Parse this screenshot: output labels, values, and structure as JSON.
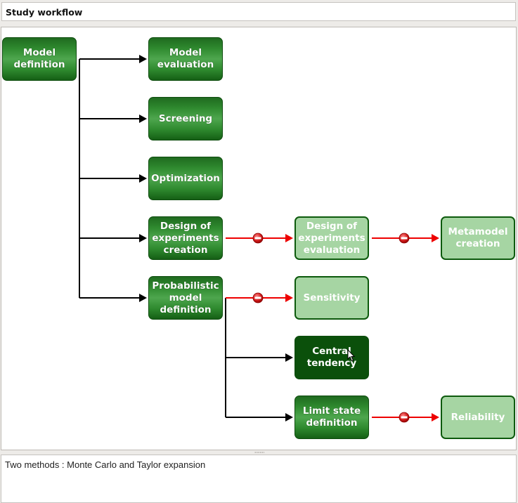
{
  "window": {
    "title": "Study workflow"
  },
  "workflow": {
    "nodes": [
      {
        "id": "model-definition",
        "label": "Model definition",
        "state": "active"
      },
      {
        "id": "model-evaluation",
        "label": "Model evaluation",
        "state": "active"
      },
      {
        "id": "screening",
        "label": "Screening",
        "state": "active"
      },
      {
        "id": "optimization",
        "label": "Optimization",
        "state": "active"
      },
      {
        "id": "doe-creation",
        "label": "Design of experiments creation",
        "state": "active"
      },
      {
        "id": "doe-evaluation",
        "label": "Design of experiments evaluation",
        "state": "inactive"
      },
      {
        "id": "metamodel-creation",
        "label": "Metamodel creation",
        "state": "inactive"
      },
      {
        "id": "probabilistic-model",
        "label": "Probabilistic model definition",
        "state": "active"
      },
      {
        "id": "sensitivity",
        "label": "Sensitivity",
        "state": "inactive"
      },
      {
        "id": "central-tendency",
        "label": "Central tendency",
        "state": "selected"
      },
      {
        "id": "limit-state",
        "label": "Limit state definition",
        "state": "active"
      },
      {
        "id": "reliability",
        "label": "Reliability",
        "state": "inactive"
      }
    ],
    "edges": [
      {
        "from": "model-definition",
        "to": "model-evaluation",
        "status": "enabled"
      },
      {
        "from": "model-definition",
        "to": "screening",
        "status": "enabled"
      },
      {
        "from": "model-definition",
        "to": "optimization",
        "status": "enabled"
      },
      {
        "from": "model-definition",
        "to": "doe-creation",
        "status": "enabled"
      },
      {
        "from": "model-definition",
        "to": "probabilistic-model",
        "status": "enabled"
      },
      {
        "from": "doe-creation",
        "to": "doe-evaluation",
        "status": "blocked"
      },
      {
        "from": "doe-evaluation",
        "to": "metamodel-creation",
        "status": "blocked"
      },
      {
        "from": "probabilistic-model",
        "to": "sensitivity",
        "status": "blocked"
      },
      {
        "from": "probabilistic-model",
        "to": "central-tendency",
        "status": "enabled"
      },
      {
        "from": "probabilistic-model",
        "to": "limit-state",
        "status": "enabled"
      },
      {
        "from": "limit-state",
        "to": "reliability",
        "status": "blocked"
      }
    ],
    "colors": {
      "enabled_edge": "#000000",
      "blocked_edge": "#ee0000",
      "active_node": "#2f8a2f",
      "inactive_node": "#a6d5a3",
      "selected_node": "#0b500b"
    }
  },
  "description": {
    "text": "Two methods : Monte Carlo and Taylor expansion"
  }
}
